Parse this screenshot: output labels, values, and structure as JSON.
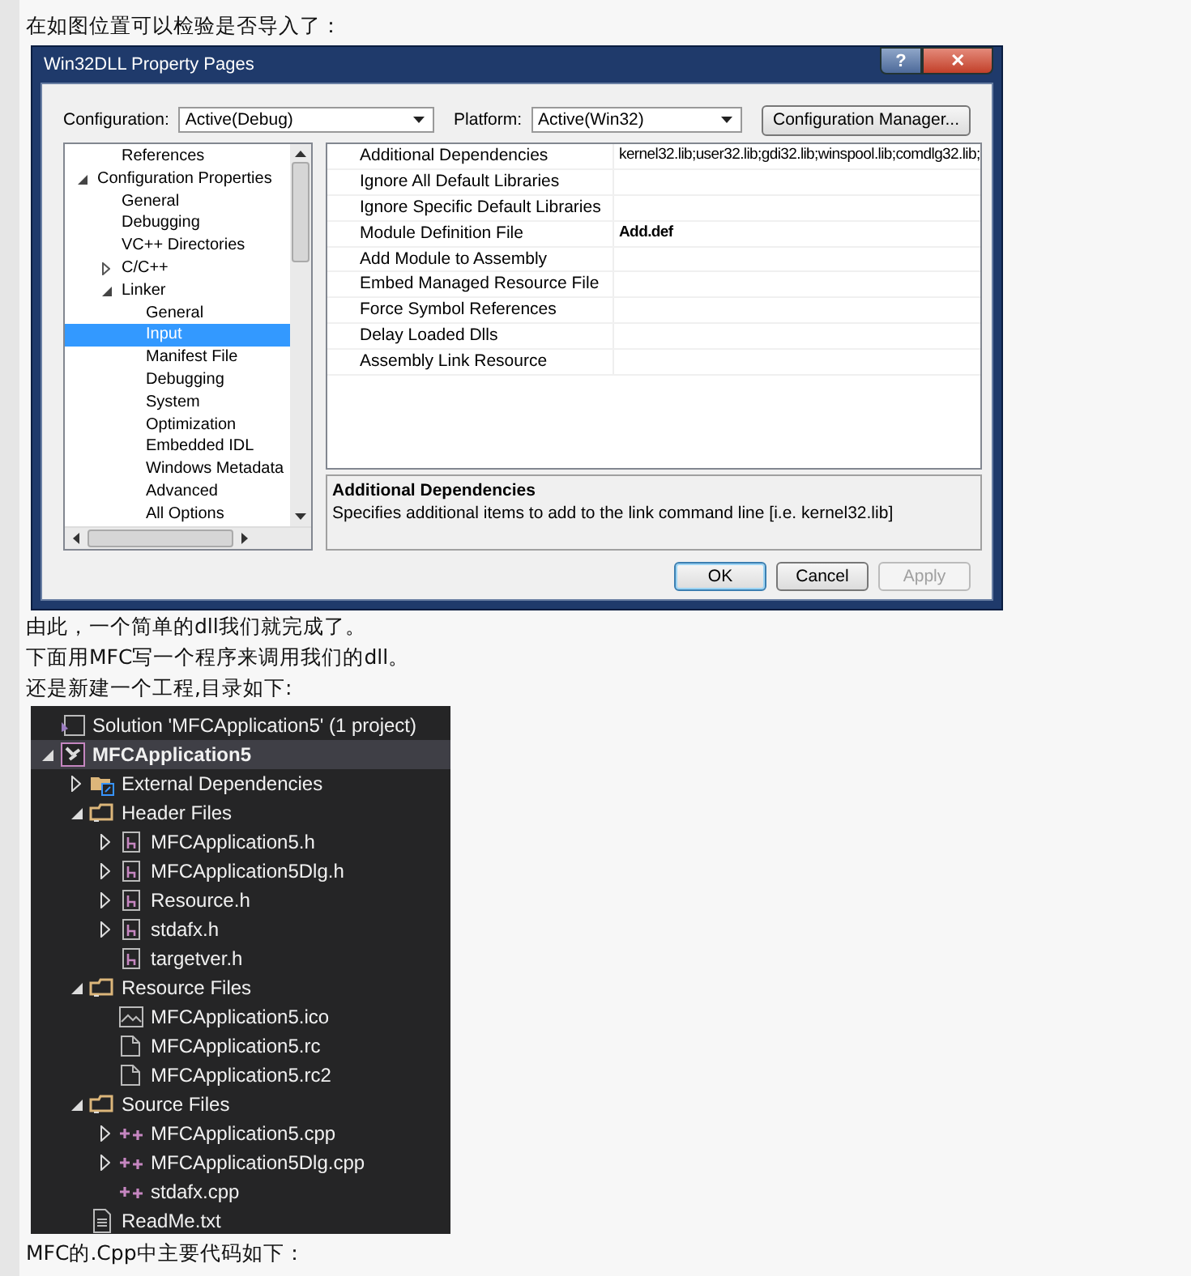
{
  "intro": "在如图位置可以检验是否导入了：",
  "dialog": {
    "title": "Win32DLL Property Pages",
    "help_button": "?",
    "close_button": "✕",
    "configuration_label": "Configuration:",
    "configuration_value": "Active(Debug)",
    "platform_label": "Platform:",
    "platform_value": "Active(Win32)",
    "manager_button": "Configuration Manager...",
    "tree": [
      {
        "children": [
          {
            "label": "References",
            "selected": false
          }
        ]
      },
      {
        "label": "Configuration Properties",
        "selected": false,
        "expanded": true,
        "children": [
          {
            "label": "General",
            "selected": false
          },
          {
            "label": "Debugging",
            "selected": false
          },
          {
            "label": "VC++ Directories",
            "selected": false
          },
          {
            "label": "C/C++",
            "selected": false,
            "expanded": false
          },
          {
            "label": "Linker",
            "selected": false,
            "expanded": true,
            "children": [
              {
                "label": "General",
                "selected": false
              },
              {
                "label": "Input",
                "selected": true
              },
              {
                "label": "Manifest File",
                "selected": false
              },
              {
                "label": "Debugging",
                "selected": false
              },
              {
                "label": "System",
                "selected": false
              },
              {
                "label": "Optimization",
                "selected": false
              },
              {
                "label": "Embedded IDL",
                "selected": false
              },
              {
                "label": "Windows Metadata",
                "selected": false
              },
              {
                "label": "Advanced",
                "selected": false
              },
              {
                "label": "All Options",
                "selected": false
              }
            ]
          }
        ]
      }
    ],
    "properties": [
      {
        "name": "Additional Dependencies",
        "value": "kernel32.lib;user32.lib;gdi32.lib;winspool.lib;comdlg32.lib;",
        "modified": false
      },
      {
        "name": "Ignore All Default Libraries"
      },
      {
        "name": "Ignore Specific Default Libraries"
      },
      {
        "name": "Module Definition File",
        "value": "Add.def",
        "modified": true
      },
      {
        "name": "Add Module to Assembly"
      },
      {
        "name": "Embed Managed Resource File"
      },
      {
        "name": "Force Symbol References"
      },
      {
        "name": "Delay Loaded Dlls"
      },
      {
        "name": "Assembly Link Resource"
      }
    ],
    "description": {
      "title": "Additional Dependencies",
      "text": "Specifies additional items to add to the link command line [i.e. kernel32.lib]"
    },
    "buttons": [
      {
        "label": "OK",
        "default": true,
        "disabled": false
      },
      {
        "label": "Cancel",
        "default": false,
        "disabled": false
      },
      {
        "label": "Apply",
        "default": false,
        "disabled": true
      }
    ]
  },
  "paragraphs": [
    "由此，一个简单的dll我们就完成了。",
    "下面用MFC写一个程序来调用我们的dll。",
    "还是新建一个工程,目录如下:"
  ],
  "solution_explorer": [
    {
      "label": "Solution 'MFCApplication5' (1 project)",
      "kind": "solution",
      "selected": false,
      "children": [
        {
          "label": "MFCApplication5",
          "kind": "project",
          "selected": true,
          "expanded": true,
          "children": [
            {
              "label": "External Dependencies",
              "kind": "external",
              "selected": false,
              "expanded": false
            },
            {
              "label": "Header Files",
              "kind": "folder",
              "selected": false,
              "expanded": true,
              "children": [
                {
                  "label": "MFCApplication5.h",
                  "kind": "header",
                  "selected": false,
                  "expanded": false
                },
                {
                  "label": "MFCApplication5Dlg.h",
                  "kind": "header",
                  "selected": false,
                  "expanded": false
                },
                {
                  "label": "Resource.h",
                  "kind": "header",
                  "selected": false,
                  "expanded": false
                },
                {
                  "label": "stdafx.h",
                  "kind": "header",
                  "selected": false,
                  "expanded": false
                },
                {
                  "label": "targetver.h",
                  "kind": "header",
                  "selected": false
                }
              ]
            },
            {
              "label": "Resource Files",
              "kind": "folder",
              "selected": false,
              "expanded": true,
              "children": [
                {
                  "label": "MFCApplication5.ico",
                  "kind": "image",
                  "selected": false
                },
                {
                  "label": "MFCApplication5.rc",
                  "kind": "resource",
                  "selected": false
                },
                {
                  "label": "MFCApplication5.rc2",
                  "kind": "resource",
                  "selected": false
                }
              ]
            },
            {
              "label": "Source Files",
              "kind": "folder",
              "selected": false,
              "expanded": true,
              "children": [
                {
                  "label": "MFCApplication5.cpp",
                  "kind": "cpp",
                  "selected": false,
                  "expanded": false
                },
                {
                  "label": "MFCApplication5Dlg.cpp",
                  "kind": "cpp",
                  "selected": false,
                  "expanded": false
                },
                {
                  "label": "stdafx.cpp",
                  "kind": "cpp",
                  "selected": false
                }
              ]
            },
            {
              "label": "ReadMe.txt",
              "kind": "text",
              "selected": false
            }
          ]
        }
      ]
    }
  ],
  "outro": "MFC的.Cpp中主要代码如下："
}
